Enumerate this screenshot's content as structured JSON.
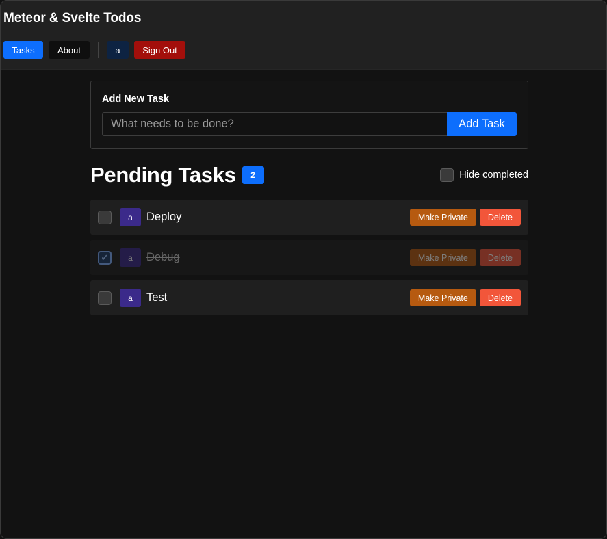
{
  "header": {
    "title": "Meteor & Svelte Todos",
    "nav": {
      "tasks_label": "Tasks",
      "about_label": "About",
      "user_label": "a",
      "signout_label": "Sign Out"
    }
  },
  "add_task": {
    "heading": "Add New Task",
    "placeholder": "What needs to be done?",
    "button_label": "Add Task"
  },
  "list": {
    "title": "Pending Tasks",
    "pending_count": "2",
    "hide_completed_label": "Hide completed",
    "hide_completed_checked": false
  },
  "tasks": [
    {
      "text": "Deploy",
      "owner": "a",
      "checked": false,
      "private_label": "Make Private",
      "delete_label": "Delete"
    },
    {
      "text": "Debug",
      "owner": "a",
      "checked": true,
      "private_label": "Make Private",
      "delete_label": "Delete"
    },
    {
      "text": "Test",
      "owner": "a",
      "checked": false,
      "private_label": "Make Private",
      "delete_label": "Delete"
    }
  ],
  "colors": {
    "primary": "#0d6efd",
    "danger_dark": "#a30f0b",
    "warning": "#b65a10",
    "delete": "#f2563a",
    "avatar": "#3b2a8a",
    "background": "#121212"
  },
  "icons": {
    "checkmark": "check-icon"
  }
}
